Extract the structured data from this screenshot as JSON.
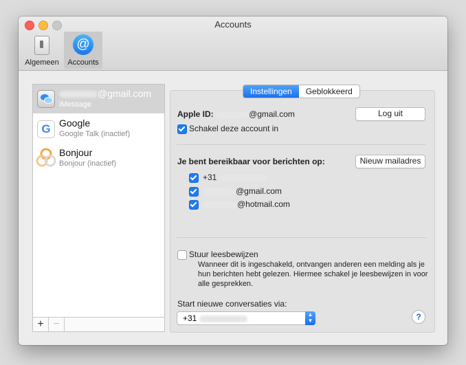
{
  "window": {
    "title": "Accounts"
  },
  "toolbar": {
    "general_label": "Algemeen",
    "accounts_label": "Accounts"
  },
  "accounts": [
    {
      "name_suffix": "@gmail.com",
      "sub": "iMessage"
    },
    {
      "name": "Google",
      "sub": "Google Talk (inactief)"
    },
    {
      "name": "Bonjour",
      "sub": "Bonjour (inactief)"
    }
  ],
  "list_footer": {
    "add": "+",
    "remove": "−"
  },
  "tabs": {
    "settings": "Instellingen",
    "blocked": "Geblokkeerd"
  },
  "settings": {
    "apple_id_label": "Apple ID:",
    "apple_id_suffix": "@gmail.com",
    "logout_button": "Log uit",
    "enable_account": "Schakel deze account in",
    "reachable_label": "Je bent bereikbaar voor berichten op:",
    "new_email_button": "Nieuw mailadres",
    "addresses": [
      {
        "prefix": "+31",
        "suffix": "",
        "checked": true
      },
      {
        "prefix": "",
        "suffix": "@gmail.com",
        "checked": true
      },
      {
        "prefix": "",
        "suffix": "@hotmail.com",
        "checked": true
      }
    ],
    "read_receipts_label": "Stuur leesbewijzen",
    "read_receipts_checked": false,
    "read_receipts_description": "Wanneer dit is ingeschakeld, ontvangen anderen een melding als je hun berichten hebt gelezen. Hiermee schakel je leesbewijzen in voor alle gesprekken.",
    "start_conversations_label": "Start nieuwe conversaties via:",
    "start_conversations_value": "+31",
    "help": "?"
  },
  "colors": {
    "accent": "#1b6ff0",
    "selection": "#d4d4d4",
    "close": "#fc605b",
    "minimize": "#fdbc40"
  }
}
